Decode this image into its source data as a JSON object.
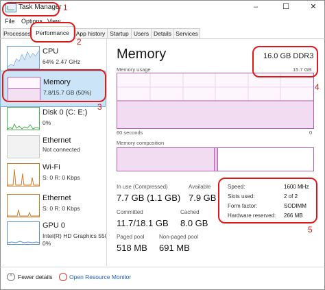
{
  "window": {
    "title": "Task Manager",
    "minimize": "–",
    "maximize": "☐",
    "close": "✕"
  },
  "menu": {
    "file": "File",
    "options": "Options",
    "view": "View"
  },
  "tabs": [
    "Processes",
    "Performance",
    "App history",
    "Startup",
    "Users",
    "Details",
    "Services"
  ],
  "sidebar": [
    {
      "name": "CPU",
      "detail1": "64%  2.47 GHz",
      "detail2": ""
    },
    {
      "name": "Memory",
      "detail1": "7.8/15.7 GB (50%)",
      "detail2": ""
    },
    {
      "name": "Disk 0 (C: E:)",
      "detail1": "0%",
      "detail2": ""
    },
    {
      "name": "Ethernet",
      "detail1": "Not connected",
      "detail2": ""
    },
    {
      "name": "Wi-Fi",
      "detail1": "S: 0  R: 0 Kbps",
      "detail2": ""
    },
    {
      "name": "Ethernet",
      "detail1": "S: 0  R: 0 Kbps",
      "detail2": ""
    },
    {
      "name": "GPU 0",
      "detail1": "Intel(R) HD Graphics 550",
      "detail2": "0%"
    }
  ],
  "main": {
    "title": "Memory",
    "spec": "16.0 GB DDR3",
    "usage_label": "Memory usage",
    "usage_max": "15.7 GB",
    "seconds_label": "60 seconds",
    "zero_label": "0",
    "composition_label": "Memory composition",
    "usage_fraction": 0.5
  },
  "stats": {
    "in_use_label": "In use (Compressed)",
    "in_use": "7.7 GB (1.1 GB)",
    "available_label": "Available",
    "available": "7.9 GB",
    "committed_label": "Committed",
    "committed": "11.7/18.1 GB",
    "cached_label": "Cached",
    "cached": "8.0 GB",
    "paged_label": "Paged pool",
    "paged": "518 MB",
    "nonpaged_label": "Non-paged pool",
    "nonpaged": "691 MB"
  },
  "right": {
    "speed_label": "Speed:",
    "speed": "1600 MHz",
    "slots_label": "Slots used:",
    "slots": "2 of 2",
    "form_label": "Form factor:",
    "form": "SODIMM",
    "reserved_label": "Hardware reserved:",
    "reserved": "266 MB"
  },
  "footer": {
    "fewer": "Fewer details",
    "monitor": "Open Resource Monitor"
  },
  "annotations": [
    "1",
    "2",
    "3",
    "4",
    "5"
  ],
  "colors": {
    "annotation": "#e01818",
    "memory_graph": "#b45cb4",
    "selection": "#cce4f7"
  }
}
